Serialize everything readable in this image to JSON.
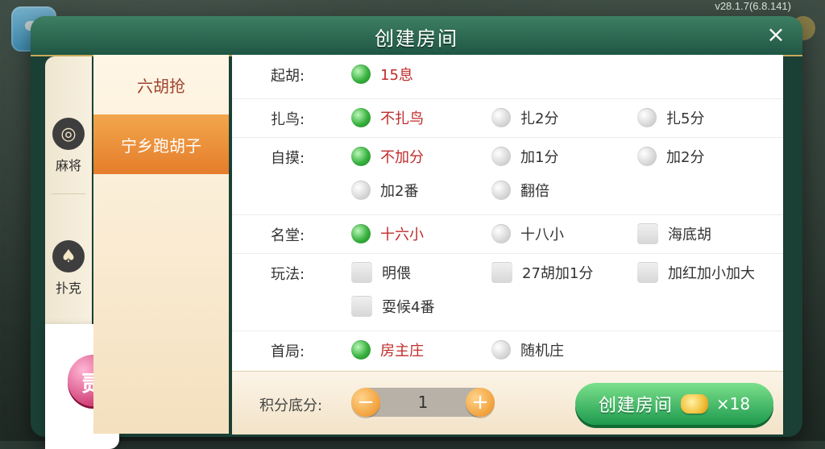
{
  "app": {
    "version": "v28.1.7(6.8.141)"
  },
  "dialog": {
    "title": "创建房间",
    "close_icon": "×"
  },
  "categories": [
    {
      "label": "麻将",
      "icon": "mahjong-icon"
    },
    {
      "label": "扑克",
      "icon": "spade-icon"
    },
    {
      "label": "贰",
      "icon": "er-badge-icon"
    }
  ],
  "subcategories": [
    {
      "label": "六胡抢"
    },
    {
      "label": "宁乡跑胡子",
      "active": true
    }
  ],
  "options": {
    "qihu": {
      "label": "起胡:",
      "items": [
        {
          "text": "15息",
          "selected": true,
          "type": "radio"
        }
      ]
    },
    "zhaniao": {
      "label": "扎鸟:",
      "items": [
        {
          "text": "不扎鸟",
          "selected": true,
          "type": "radio"
        },
        {
          "text": "扎2分",
          "selected": false,
          "type": "radio"
        },
        {
          "text": "扎5分",
          "selected": false,
          "type": "radio"
        }
      ]
    },
    "zimo": {
      "label": "自摸:",
      "items": [
        {
          "text": "不加分",
          "selected": true,
          "type": "radio"
        },
        {
          "text": "加1分",
          "selected": false,
          "type": "radio"
        },
        {
          "text": "加2分",
          "selected": false,
          "type": "radio"
        },
        {
          "text": "加2番",
          "selected": false,
          "type": "radio"
        },
        {
          "text": "翻倍",
          "selected": false,
          "type": "radio"
        }
      ]
    },
    "mingtang": {
      "label": "名堂:",
      "items": [
        {
          "text": "十六小",
          "selected": true,
          "type": "radio"
        },
        {
          "text": "十八小",
          "selected": false,
          "type": "radio"
        },
        {
          "text": "海底胡",
          "selected": false,
          "type": "checkbox"
        }
      ]
    },
    "wanfa": {
      "label": "玩法:",
      "items": [
        {
          "text": "明偎",
          "selected": false,
          "type": "checkbox"
        },
        {
          "text": "27胡加1分",
          "selected": false,
          "type": "checkbox"
        },
        {
          "text": "加红加小加大",
          "selected": false,
          "type": "checkbox"
        },
        {
          "text": "耍候4番",
          "selected": false,
          "type": "checkbox"
        }
      ]
    },
    "shouju": {
      "label": "首局:",
      "items": [
        {
          "text": "房主庄",
          "selected": true,
          "type": "radio"
        },
        {
          "text": "随机庄",
          "selected": false,
          "type": "radio"
        }
      ]
    }
  },
  "bottom": {
    "score_label": "积分底分:",
    "score_value": "1",
    "minus": "−",
    "plus": "+",
    "create_label": "创建房间",
    "cost": "×18"
  },
  "colors": {
    "selected_text": "#c12b2b",
    "radio_on": "#37b13e",
    "create_button": "#1e9a4e",
    "subcategory_active": "#e57d2b"
  }
}
